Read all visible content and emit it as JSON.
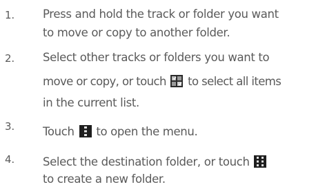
{
  "steps": [
    {
      "number": "1.",
      "lines": [
        "Press and hold the track or folder you want",
        "to move or copy to another folder."
      ]
    },
    {
      "number": "2.",
      "lines": [
        "Select other tracks or folders you want to",
        {
          "before": "move or copy, or touch",
          "icon": "select-all-icon",
          "after": "to select all items"
        },
        "in the current list."
      ]
    },
    {
      "number": "3.",
      "lines": [
        {
          "before": "Touch",
          "icon": "menu-icon",
          "after": "to open the menu."
        }
      ]
    },
    {
      "number": "4.",
      "lines": [
        {
          "before": "Select the destination folder, or touch",
          "icon": "new-folder-icon",
          "after": ""
        },
        "to create a new folder."
      ]
    }
  ]
}
